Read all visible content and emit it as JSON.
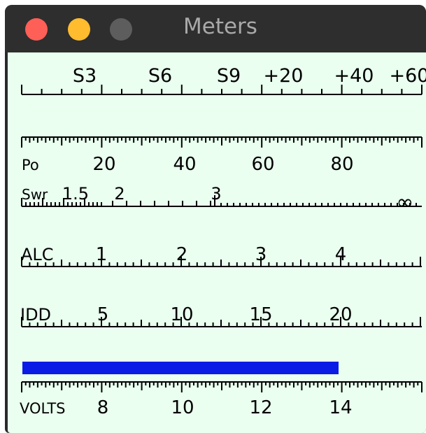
{
  "window": {
    "title": "Meters"
  },
  "accent": {
    "bar_color": "#0a1be6",
    "background": "#eafff0"
  },
  "meters": {
    "s_meter": {
      "labels": [
        "S3",
        "S6",
        "S9",
        "+20",
        "+40",
        "+60"
      ]
    },
    "po": {
      "name": "Po",
      "labels": [
        "20",
        "40",
        "60",
        "80"
      ]
    },
    "swr": {
      "name": "Swr",
      "labels": [
        "1.5",
        "2",
        "3",
        "∞"
      ]
    },
    "alc": {
      "name": "ALC",
      "labels": [
        "1",
        "2",
        "3",
        "4"
      ]
    },
    "idd": {
      "name": "IDD",
      "labels": [
        "5",
        "10",
        "15",
        "20"
      ]
    },
    "volts": {
      "name": "VOLTS",
      "labels": [
        "8",
        "10",
        "12",
        "14"
      ],
      "level_fraction": 0.79
    }
  }
}
